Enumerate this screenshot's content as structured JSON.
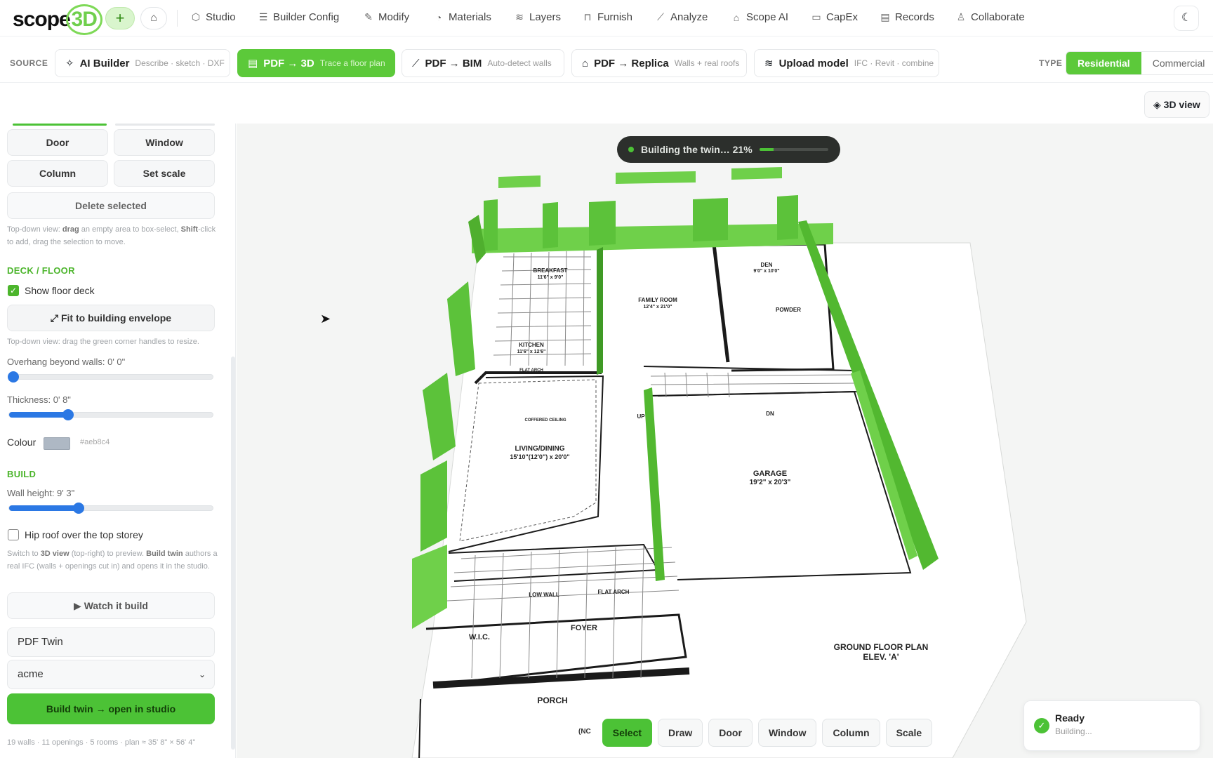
{
  "brand": {
    "name": "scope",
    "suffix": "3D"
  },
  "nav": [
    {
      "label": "Studio",
      "icon": "cube-icon"
    },
    {
      "label": "Builder Config",
      "icon": "sliders-icon"
    },
    {
      "label": "Modify",
      "icon": "pencil-icon"
    },
    {
      "label": "Materials",
      "icon": "palette-icon"
    },
    {
      "label": "Layers",
      "icon": "layers-icon"
    },
    {
      "label": "Furnish",
      "icon": "sofa-icon"
    },
    {
      "label": "Analyze",
      "icon": "ruler-icon"
    },
    {
      "label": "Scope AI",
      "icon": "robot-icon"
    },
    {
      "label": "CapEx",
      "icon": "wallet-icon"
    },
    {
      "label": "Records",
      "icon": "clipboard-icon"
    },
    {
      "label": "Collaborate",
      "icon": "users-icon"
    }
  ],
  "source": {
    "label": "SOURCE",
    "cards": [
      {
        "title": "AI Builder",
        "sub": "Describe · sketch · DXF"
      },
      {
        "title": "PDF → 3D",
        "sub": "Trace a floor plan",
        "active": true
      },
      {
        "title": "PDF → BIM",
        "sub": "Auto-detect walls"
      },
      {
        "title": "PDF → Replica",
        "sub": "Walls + real roofs"
      },
      {
        "title": "Upload model",
        "sub": "IFC · Revit · combine"
      }
    ],
    "type_label": "TYPE",
    "types": [
      "Residential",
      "Commercial"
    ],
    "active_type": "Residential"
  },
  "view_button": "◈ 3D view",
  "sidebar": {
    "buttons": {
      "door": "Door",
      "window": "Window",
      "column": "Column",
      "set_scale": "Set scale",
      "delete": "Delete selected"
    },
    "hint_select_pre": "Top-down view: ",
    "hint_select_drag": "drag",
    "hint_select_mid": " an empty area to box-select, ",
    "hint_select_shift": "Shift",
    "hint_select_post": "-click to add, drag the selection to move.",
    "deck_title": "DECK / FLOOR",
    "show_floor_deck": "Show floor deck",
    "fit_button": "⤢ Fit to building envelope",
    "hint_deck": "Top-down view: drag the green corner handles to resize.",
    "overhang_label": "Overhang beyond walls: 0' 0\"",
    "overhang_value": 0,
    "thickness_label": "Thickness: 0' 8\"",
    "thickness_value": 0.29,
    "colour_label": "Colour",
    "colour_hex": "#aeb8c4",
    "build_title": "BUILD",
    "wall_height_label": "Wall height: 9' 3\"",
    "wall_height_value": 0.34,
    "hip_roof": "Hip roof over the top storey",
    "hint_build_1": "Switch to ",
    "hint_build_3d": "3D view",
    "hint_build_2": " (top-right) to preview. ",
    "hint_build_twin": "Build twin",
    "hint_build_3": " authors a real IFC (walls + openings cut in) and opens it in the studio.",
    "watch_button": "▶ Watch it build",
    "twin_name": "PDF Twin",
    "org_select": "acme",
    "build_button": "Build twin → open in studio",
    "footnote": "19 walls · 11 openings · 5 rooms · plan ≈ 35' 8\" × 56' 4\""
  },
  "progress": {
    "text": "Building the twin… 21%",
    "value": 0.21
  },
  "plan": {
    "rooms": [
      "BREAKFAST",
      "KITCHEN",
      "FAMILY ROOM",
      "DEN",
      "POWDER",
      "LIVING/DINING",
      "GARAGE",
      "W.I.C.",
      "FOYER",
      "PORCH"
    ],
    "dims": [
      "11'6\" x 9'0\"",
      "11'6\" x 12'6\"",
      "12'4\" x 21'0\"",
      "9'0\" x 10'0\"",
      "15'10\"(12'0\") x 20'0\"",
      "19'2\" x 20'3\""
    ],
    "notes": [
      "FLAT ARCH",
      "LOW WALL",
      "FLAT ARCH",
      "UP",
      "DN",
      "COFFERED CEILING"
    ],
    "caption1": "GROUND FLOOR PLAN",
    "caption2": "ELEV. 'A'"
  },
  "tools": [
    "Select",
    "Draw",
    "Door",
    "Window",
    "Column",
    "Scale"
  ],
  "active_tool": "Select",
  "toast": {
    "title": "Ready",
    "sub": "Building..."
  },
  "colors": {
    "accent": "#4cc236",
    "wall": "#6fd04a",
    "wall_dark": "#3f9a25"
  }
}
